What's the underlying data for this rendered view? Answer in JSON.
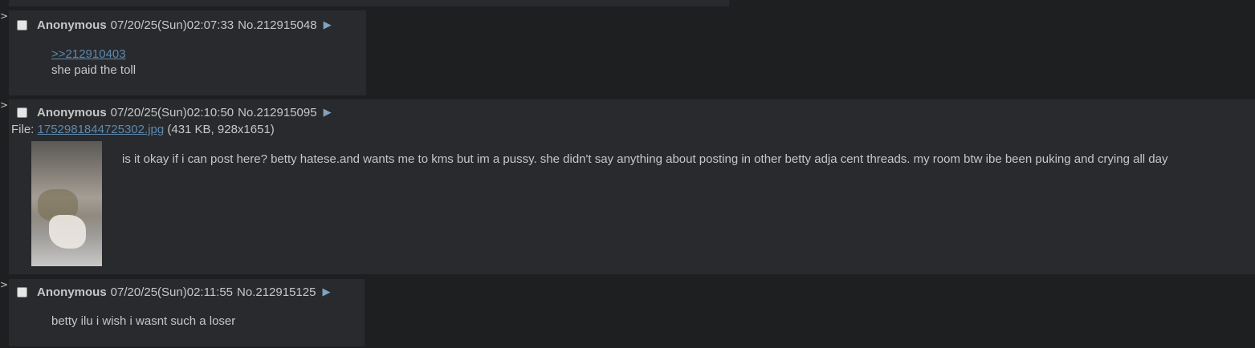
{
  "posts": [
    {
      "name": "Anonymous",
      "datetime": "07/20/25(Sun)02:07:33",
      "number": "No.212915048",
      "quote": ">>212910403",
      "message": "she paid the toll"
    },
    {
      "name": "Anonymous",
      "datetime": "07/20/25(Sun)02:10:50",
      "number": "No.212915095",
      "file_label": "File:",
      "file_name": "1752981844725302.jpg",
      "file_info": "(431 KB, 928x1651)",
      "message": "is it okay if i can post here? betty hatese.and wants me to kms but im a pussy. she didn't say anything about posting in other betty adja cent threads. my room btw ibe been puking and crying all day"
    },
    {
      "name": "Anonymous",
      "datetime": "07/20/25(Sun)02:11:55",
      "number": "No.212915125",
      "message": "betty ilu i wish i wasnt such a loser"
    }
  ],
  "side_arrow": ">",
  "menu_arrow": "▶",
  "colors": {
    "background": "#1d1f21",
    "post_background": "#282a2e",
    "text": "#c5c8c6",
    "link": "#5f89ac",
    "menu_arrow": "#81a2be"
  }
}
